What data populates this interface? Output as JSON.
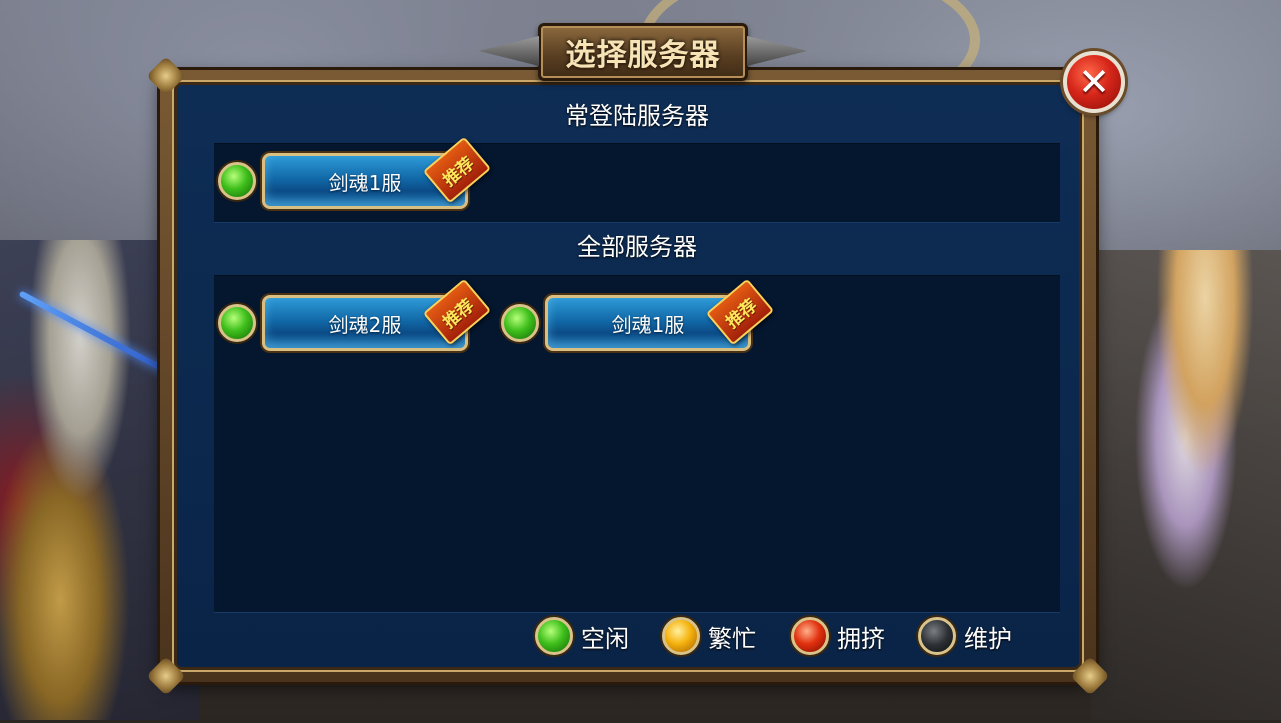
{
  "title": "选择服务器",
  "close_icon": "close-x-icon",
  "sections": {
    "recent": {
      "title": "常登陆服务器",
      "servers": [
        {
          "name": "剑魂1服",
          "status": "green",
          "badge": "推荐"
        }
      ]
    },
    "all": {
      "title": "全部服务器",
      "servers": [
        {
          "name": "剑魂2服",
          "status": "green",
          "badge": "推荐"
        },
        {
          "name": "剑魂1服",
          "status": "green",
          "badge": "推荐"
        }
      ]
    }
  },
  "legend": [
    {
      "label": "空闲",
      "color": "#3fbf1c"
    },
    {
      "label": "繁忙",
      "color": "#f5b20e"
    },
    {
      "label": "拥挤",
      "color": "#e2320f"
    },
    {
      "label": "维护",
      "color": "#2c3034"
    }
  ]
}
